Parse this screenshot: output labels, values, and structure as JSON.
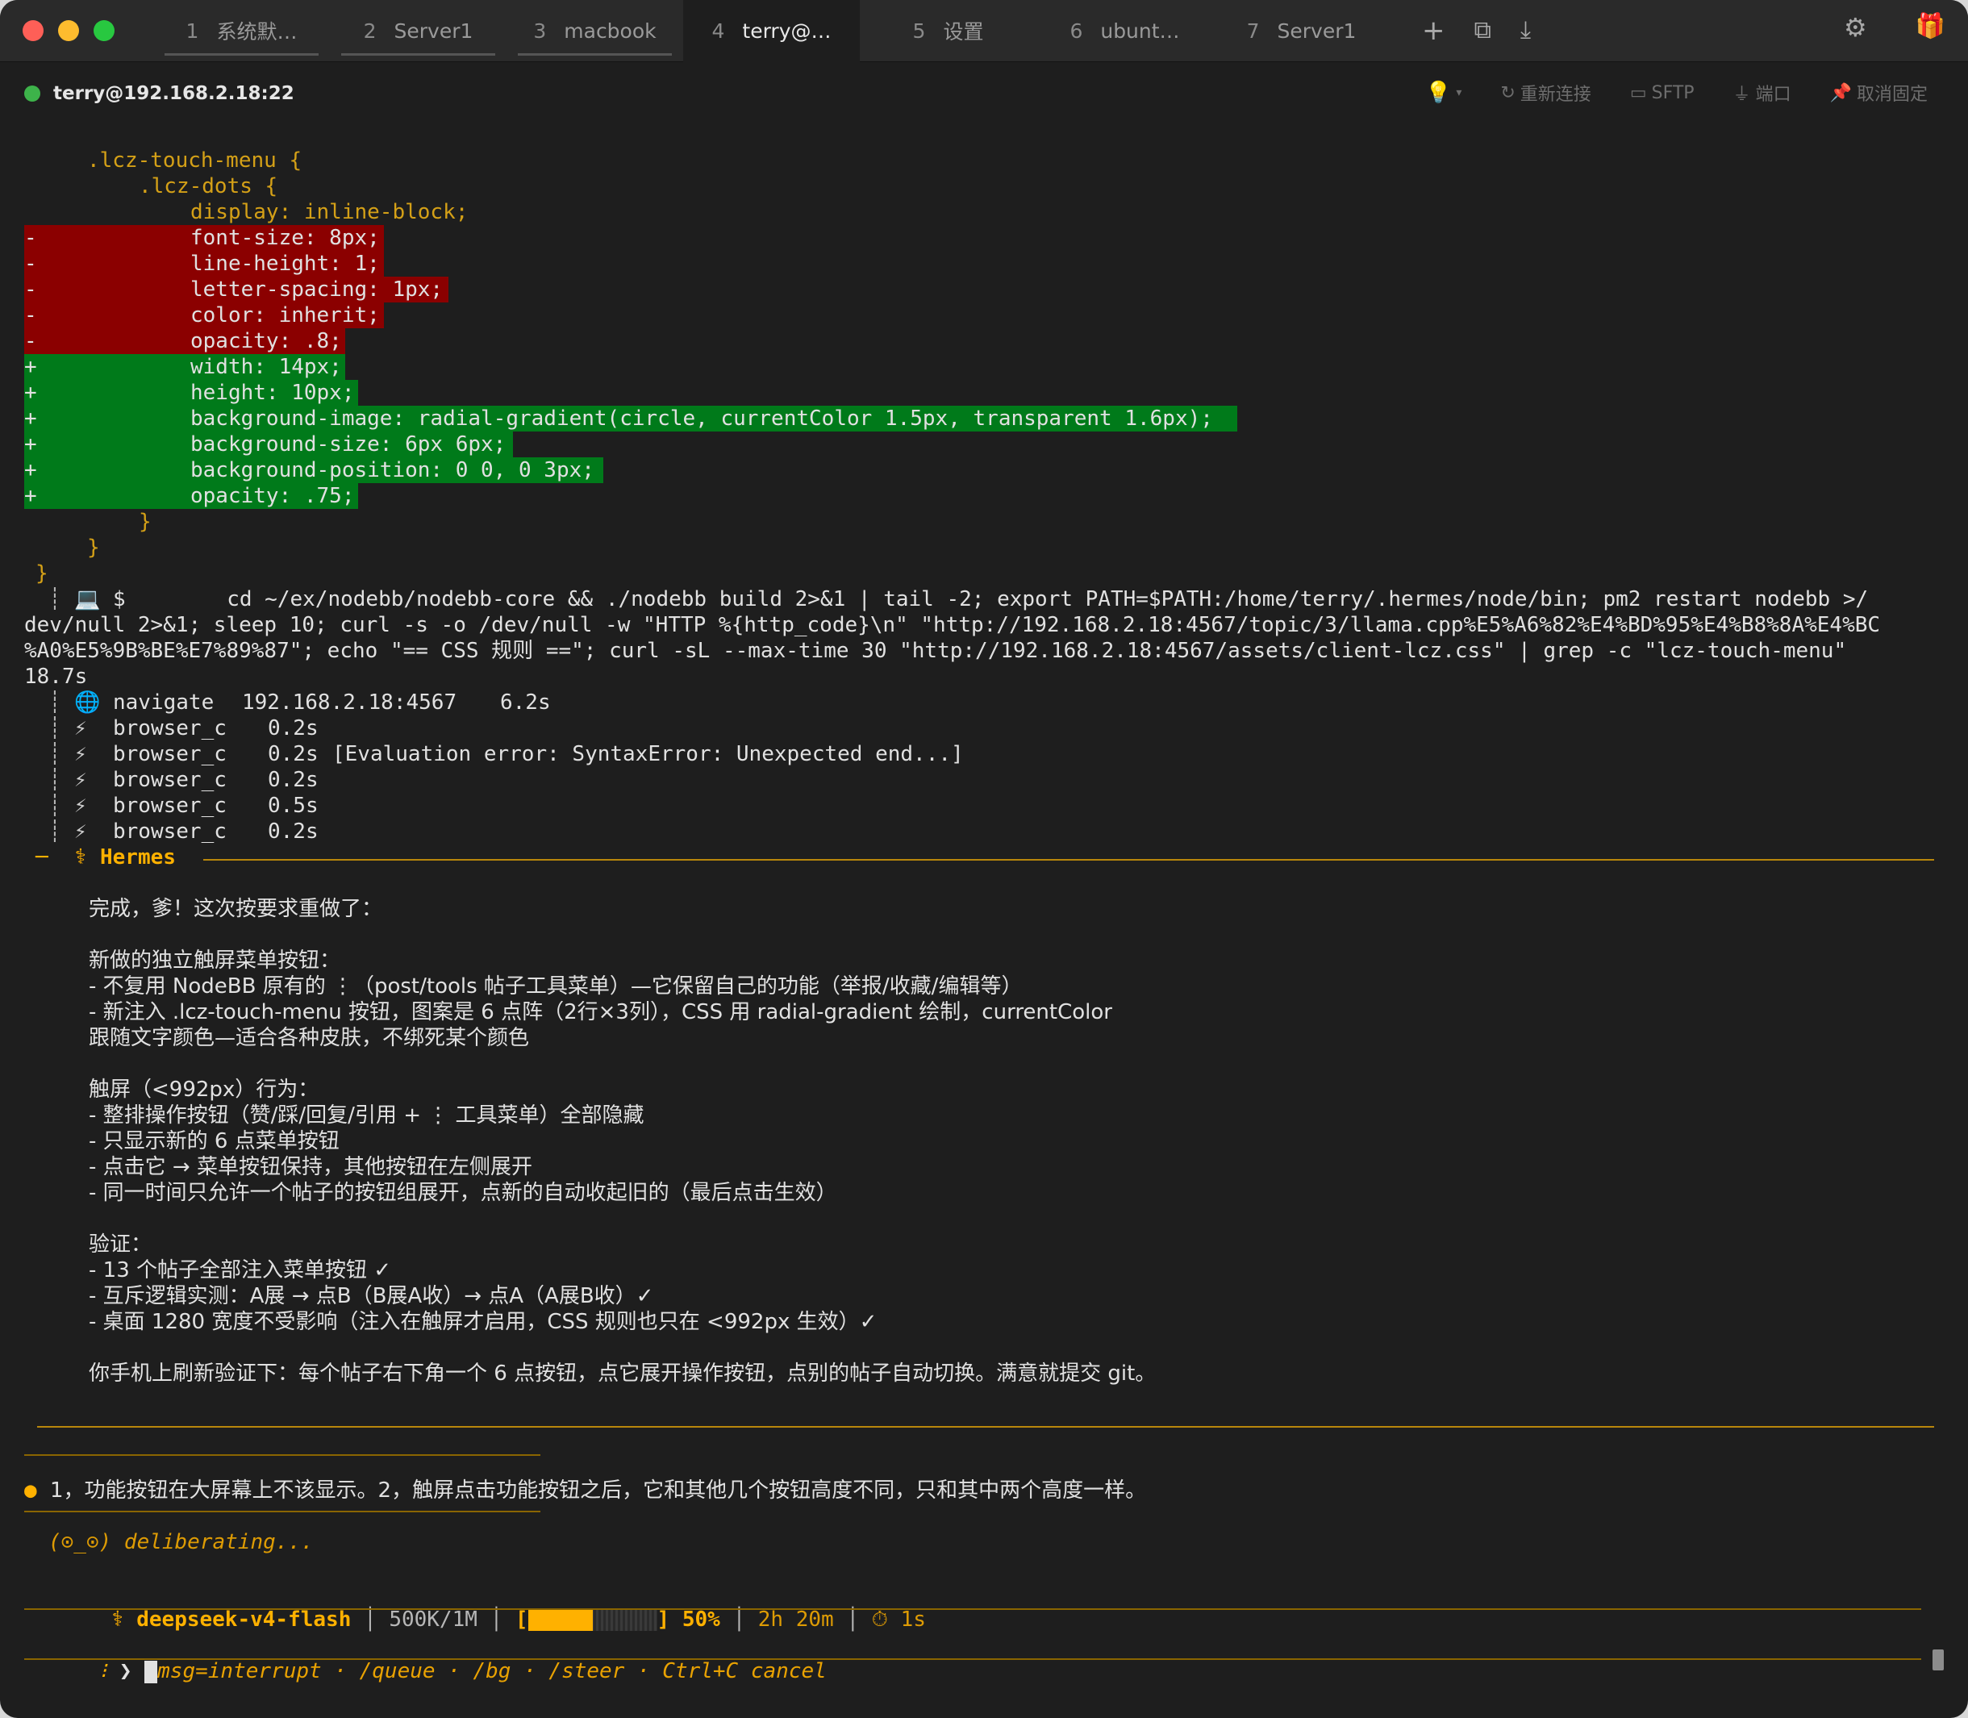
{
  "tabbar": {
    "tabs": [
      {
        "num": "1",
        "label": "系统默…",
        "active": false
      },
      {
        "num": "2",
        "label": "Server1",
        "active": false
      },
      {
        "num": "3",
        "label": "macbook",
        "active": false
      },
      {
        "num": "4",
        "label": "terry@…",
        "active": true
      },
      {
        "num": "5",
        "label": "设置",
        "active": false
      },
      {
        "num": "6",
        "label": "ubunt…",
        "active": false
      },
      {
        "num": "7",
        "label": "Server1",
        "active": false
      }
    ],
    "add_icon": "plus-icon",
    "window_icon": "window-icon",
    "download_icon": "download-icon",
    "settings_icon": "gear-icon",
    "gift_icon": "gift-icon"
  },
  "header": {
    "host": "terry@192.168.2.18:22",
    "status_color": "#3db34a",
    "actions": {
      "reconnect": "重新连接",
      "sftp": "SFTP",
      "port": "端口",
      "unpin": "取消固定"
    }
  },
  "diff": {
    "l1": ".lcz-touch-menu {",
    "l2": ".lcz-dots {",
    "l3": "display: inline-block;",
    "removed": [
      "font-size: 8px;",
      "line-height: 1;",
      "letter-spacing: 1px;",
      "color: inherit;",
      "opacity: .8;"
    ],
    "added": [
      "width: 14px;",
      "height: 10px;",
      "background-image: radial-gradient(circle, currentColor 1.5px, transparent 1.6px);",
      "background-size: 6px 6px;",
      "background-position: 0 0, 0 3px;",
      "opacity: .75;"
    ],
    "minus": "-",
    "plus": "+",
    "close1": "}",
    "close2": "}",
    "close3": "}"
  },
  "command": {
    "prompt": "$",
    "line1": "        cd ~/ex/nodebb/nodebb-core && ./nodebb build 2>&1 | tail -2; export PATH=$PATH:/home/terry/.hermes/node/bin; pm2 restart nodebb >/",
    "line2": "dev/null 2>&1; sleep 10; curl -s -o /dev/null -w \"HTTP %{http_code}\\n\" \"http://192.168.2.18:4567/topic/3/llama.cpp%E5%A6%82%E4%BD%95%E4%B8%8A%E4%BC",
    "line3": "%A0%E5%9B%BE%E7%89%87\"; echo \"== CSS 规则 ==\"; curl -sL --max-time 30 \"http://192.168.2.18:4567/assets/client-lcz.css\" | grep -c \"lcz-touch-menu\"",
    "line4": "18.7s"
  },
  "tools": [
    {
      "icon": "🌐",
      "name": "navigate",
      "arg": "192.168.2.18:4567",
      "time": "6.2s",
      "note": ""
    },
    {
      "icon": "⚡",
      "name": "browser_c",
      "arg": "",
      "time": "0.2s",
      "note": ""
    },
    {
      "icon": "⚡",
      "name": "browser_c",
      "arg": "",
      "time": "0.2s",
      "note": "[Evaluation error: SyntaxError: Unexpected end...]"
    },
    {
      "icon": "⚡",
      "name": "browser_c",
      "arg": "",
      "time": "0.2s",
      "note": ""
    },
    {
      "icon": "⚡",
      "name": "browser_c",
      "arg": "",
      "time": "0.5s",
      "note": ""
    },
    {
      "icon": "⚡",
      "name": "browser_c",
      "arg": "",
      "time": "0.2s",
      "note": ""
    }
  ],
  "hermes": {
    "label": "Hermes",
    "lines": [
      "完成，爹！这次按要求重做了：",
      "",
      "新做的独立触屏菜单按钮：",
      "- 不复用 NodeBB 原有的 ⋮（post/tools 帖子工具菜单）—它保留自己的功能（举报/收藏/编辑等）",
      "- 新注入 .lcz-touch-menu 按钮，图案是 6 点阵（2行×3列），CSS 用 radial-gradient 绘制，currentColor",
      "跟随文字颜色—适合各种皮肤，不绑死某个颜色",
      "",
      "触屏（<992px）行为：",
      "- 整排操作按钮（赞/踩/回复/引用 + ⋮ 工具菜单）全部隐藏",
      "- 只显示新的 6 点菜单按钮",
      "- 点击它 → 菜单按钮保持，其他按钮在左侧展开",
      "- 同一时间只允许一个帖子的按钮组展开，点新的自动收起旧的（最后点击生效）",
      "",
      "验证：",
      "- 13 个帖子全部注入菜单按钮 ✓",
      "- 互斥逻辑实测：A展 → 点B（B展A收）→ 点A（A展B收）✓",
      "- 桌面 1280 宽度不受影响（注入在触屏才启用，CSS 规则也只在 <992px 生效）✓",
      "",
      "你手机上刷新验证下：每个帖子右下角一个 6 点按钮，点它展开操作按钮，点别的帖子自动切换。满意就提交 git。"
    ]
  },
  "user_msg": "1，功能按钮在大屏幕上不该显示。2，触屏点击功能按钮之后，它和其他几个按钮高度不同，只和其中两个高度一样。",
  "status": {
    "thinking": "(⊙_⊙) deliberating...",
    "model": "deepseek-v4-flash",
    "tokens": "500K/1M",
    "progress_pct": 50,
    "progress_text": "50%",
    "elapsed": "2h 20m",
    "timer": "1s"
  },
  "input": {
    "prompt": "❯",
    "placeholder": "msg=interrupt · /queue · /bg · /steer · Ctrl+C cancel"
  }
}
